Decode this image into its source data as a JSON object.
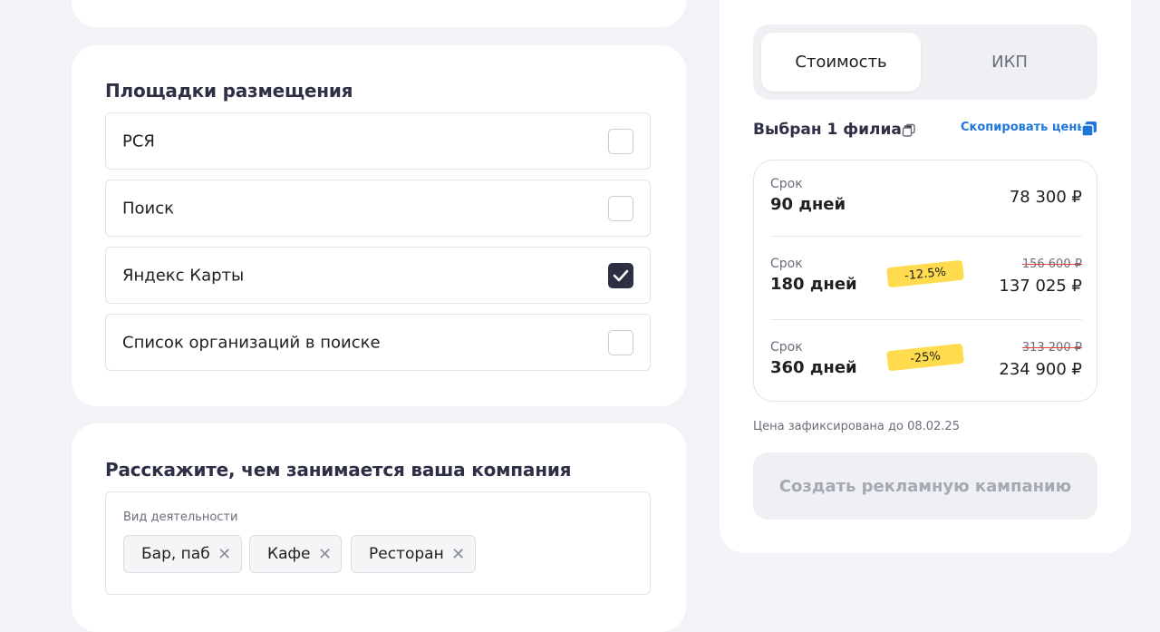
{
  "placements": {
    "title": "Площадки размещения",
    "options": [
      {
        "label": "РСЯ",
        "checked": false
      },
      {
        "label": "Поиск",
        "checked": false
      },
      {
        "label": "Яндекс Карты",
        "checked": true
      },
      {
        "label": "Список организаций в поиске",
        "checked": false
      }
    ]
  },
  "about": {
    "title": "Расскажите, чем занимается ваша компания",
    "activity_label": "Вид деятельности",
    "chips": [
      "Бар, паб",
      "Кафе",
      "Ресторан"
    ]
  },
  "pricing": {
    "tabs": [
      "Стоимость",
      "ИКП"
    ],
    "active_tab": "Стоимость",
    "branch_title": "Выбран 1 филиал",
    "copy_prices": "Скопировать цены",
    "rows": [
      {
        "label": "Срок",
        "duration": "90 дней",
        "price": "78 300 ₽",
        "old_price": "",
        "discount": ""
      },
      {
        "label": "Срок",
        "duration": "180 дней",
        "price": "137 025 ₽",
        "old_price": "156 600 ₽",
        "discount": "-12.5%"
      },
      {
        "label": "Срок",
        "duration": "360 дней",
        "price": "234 900 ₽",
        "old_price": "313 200 ₽",
        "discount": "-25%"
      }
    ],
    "fixed_note": "Цена зафиксирована до 08.02.25",
    "create_button": "Создать рекламную кампанию"
  },
  "colors": {
    "accent_dark": "#2d2f44",
    "link_blue": "#1e77d9",
    "badge_yellow": "#ffdb4d",
    "background": "#f2f3f6"
  }
}
